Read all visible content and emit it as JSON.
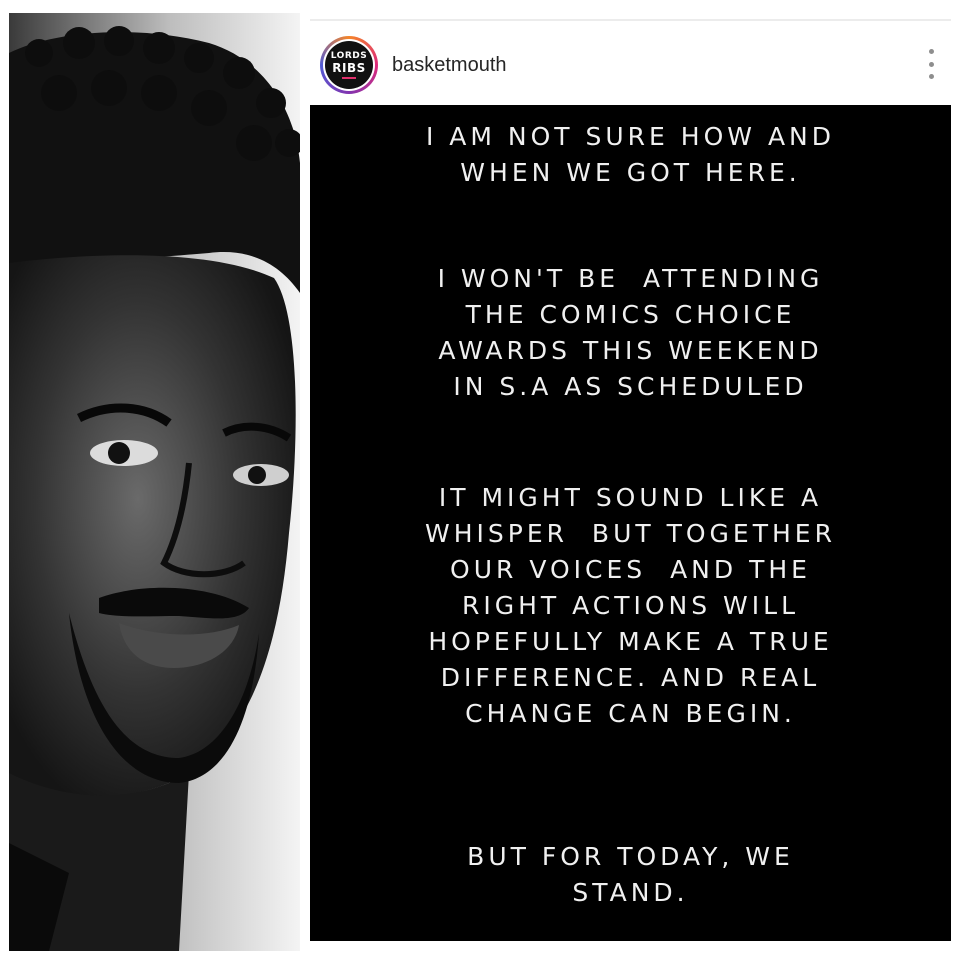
{
  "post": {
    "username": "basketmouth",
    "avatar": {
      "line1": "LORDS",
      "line2": "RIBS"
    },
    "more_icon": "more-vertical-icon",
    "story_paragraphs": [
      [
        "I AM NOT SURE HOW AND",
        "WHEN WE GOT HERE."
      ],
      [
        "I WON'T BE  ATTENDING",
        "THE COMICS CHOICE",
        "AWARDS THIS WEEKEND",
        "IN S.A AS SCHEDULED"
      ],
      [
        "IT MIGHT SOUND LIKE A",
        "WHISPER  BUT TOGETHER",
        "OUR VOICES  AND THE",
        "RIGHT ACTIONS WILL",
        "HOPEFULLY MAKE A TRUE",
        "DIFFERENCE. AND REAL",
        "CHANGE CAN BEGIN."
      ],
      [
        "BUT FOR TODAY, WE",
        "STAND."
      ]
    ]
  },
  "colors": {
    "post_background": "#000000",
    "post_text": "#f0f0f0",
    "username_text": "#262626",
    "story_ring": [
      "#f58529",
      "#dd2a7b",
      "#8134af",
      "#515bd4"
    ]
  }
}
